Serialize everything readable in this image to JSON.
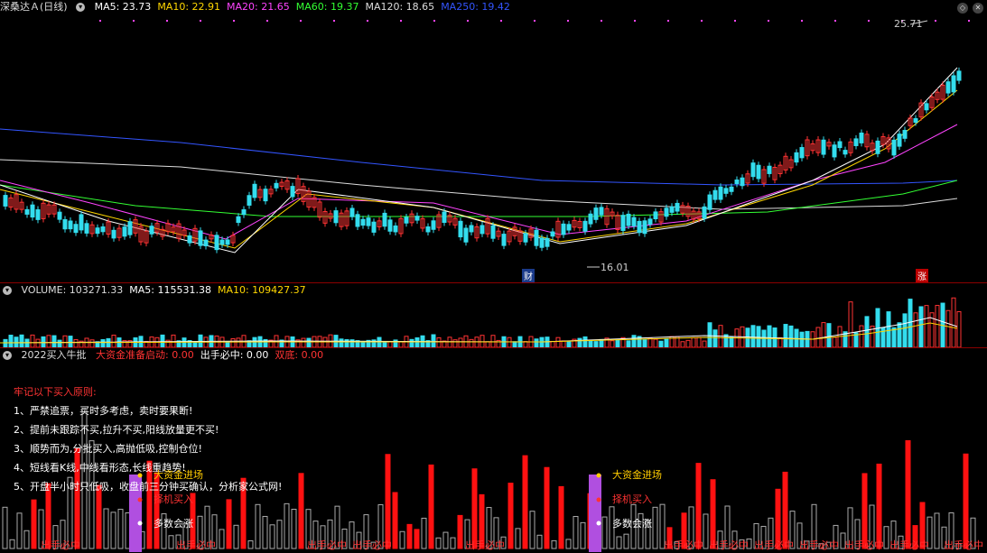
{
  "main": {
    "symbol": "深桑达Ａ(日线)",
    "ma": [
      {
        "label": "MA5: 23.73",
        "color": "#ffffff"
      },
      {
        "label": "MA10: 22.91",
        "color": "#ffd700"
      },
      {
        "label": "MA20: 21.65",
        "color": "#ff44ff"
      },
      {
        "label": "MA60: 19.37",
        "color": "#33ff33"
      },
      {
        "label": "MA120: 18.65",
        "color": "#dddddd"
      },
      {
        "label": "MA250: 19.42",
        "color": "#3355ff"
      }
    ],
    "high_label": "25.71",
    "low_label": "16.01",
    "tag_cai": "财",
    "tag_zhang": "涨"
  },
  "volume": {
    "items": [
      {
        "label": "VOLUME: 103271.33",
        "color": "#dddddd"
      },
      {
        "label": "MA5: 115531.38",
        "color": "#ffffff"
      },
      {
        "label": "MA10: 109427.37",
        "color": "#ffd700"
      }
    ]
  },
  "indicator": {
    "title": "2022买入牛批",
    "items": [
      {
        "label": "大资金准备启动: 0.00",
        "color": "#ff3333"
      },
      {
        "label": "出手必中: 0.00",
        "color": "#ffffff"
      },
      {
        "label": "双底: 0.00",
        "color": "#ff3333"
      }
    ],
    "rules_title": "牢记以下买入原则:",
    "rules": [
      "1、严禁追票，买时多考虑，卖时要果断!",
      "2、提前未跟踪不买,拉升不买,阳线放量更不买!",
      "3、顺势而为,分批买入,高抛低吸,控制仓位!",
      "4、短线看K线,中线看形态,长线重趋势!",
      "5、开盘半小时只低吸，收盘前三分钟买确认，分析家公式网!"
    ],
    "signals": [
      {
        "big": "大资金进场",
        "pick": "择机买入",
        "most": "多数会涨"
      },
      {
        "big": "大资金进场",
        "pick": "择机买入",
        "most": "多数会涨"
      }
    ],
    "bottom_text": "出手必中"
  }
}
